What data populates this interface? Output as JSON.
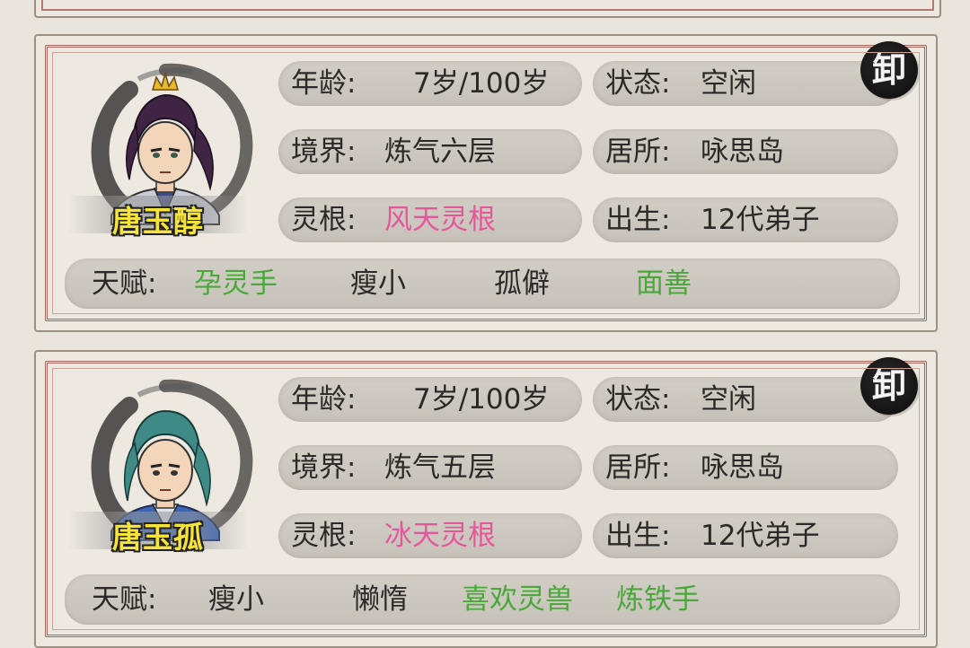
{
  "cards": [
    {
      "name": "唐玉醇",
      "seal": "卸",
      "age_label": "年龄:",
      "age_value": "7岁/100岁",
      "status_label": "状态:",
      "status_value": "空闲",
      "realm_label": "境界:",
      "realm_value": "炼气六层",
      "residence_label": "居所:",
      "residence_value": "咏思岛",
      "root_label": "灵根:",
      "root_value": "风天灵根",
      "birth_label": "出生:",
      "birth_value": "12代弟子",
      "talent_label": "天赋:",
      "talents": [
        {
          "text": "孕灵手",
          "color": "green"
        },
        {
          "text": "瘦小",
          "color": "normal"
        },
        {
          "text": "孤僻",
          "color": "normal"
        },
        {
          "text": "面善",
          "color": "green"
        }
      ]
    },
    {
      "name": "唐玉孤",
      "seal": "卸",
      "age_label": "年龄:",
      "age_value": "7岁/100岁",
      "status_label": "状态:",
      "status_value": "空闲",
      "realm_label": "境界:",
      "realm_value": "炼气五层",
      "residence_label": "居所:",
      "residence_value": "咏思岛",
      "root_label": "灵根:",
      "root_value": "冰天灵根",
      "birth_label": "出生:",
      "birth_value": "12代弟子",
      "talent_label": "天赋:",
      "talents": [
        {
          "text": "瘦小",
          "color": "normal"
        },
        {
          "text": "懒惰",
          "color": "normal"
        },
        {
          "text": "喜欢灵兽",
          "color": "green"
        },
        {
          "text": "炼铁手",
          "color": "green"
        }
      ]
    }
  ],
  "colors": {
    "root_value": "#e2589b",
    "positive_talent": "#4aa83a",
    "name_text": "#f6e43c",
    "card_border": "#a8655c"
  },
  "icons": {
    "seal": "dismiss-seal-icon",
    "portrait_1": "character-portrait-purple-hair-crown",
    "portrait_2": "character-portrait-teal-hair"
  }
}
